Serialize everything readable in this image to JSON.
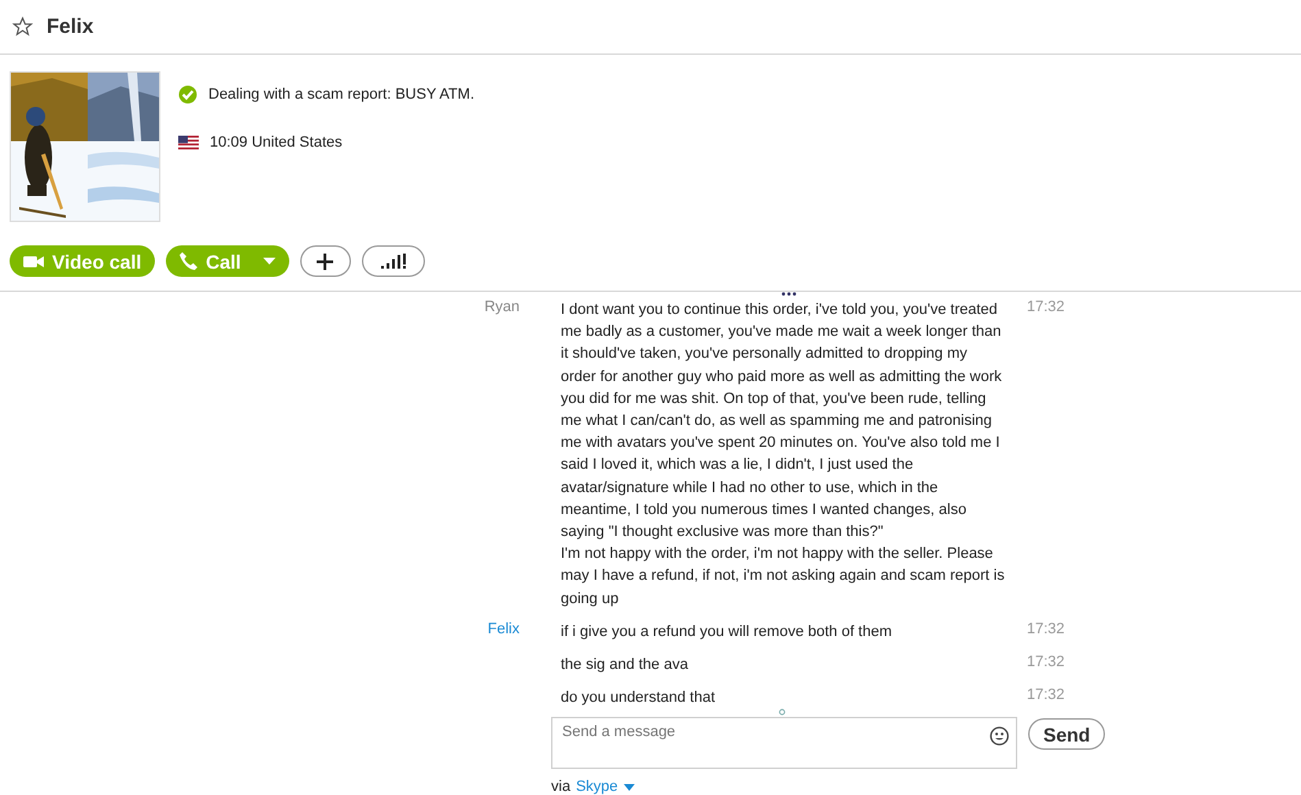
{
  "contact": {
    "name": "Felix",
    "favorite": false
  },
  "profile": {
    "kind": "picture",
    "mood": "Dealing with a scam report: BUSY ATM.",
    "local_time": "10:09 United States"
  },
  "actions": [
    {
      "kind": "video",
      "label": "Video call"
    },
    {
      "kind": "call",
      "label": "Call"
    },
    {
      "kind": "add"
    },
    {
      "kind": "quality"
    }
  ],
  "messages": [
    {
      "sender": "Ryan",
      "kind": "outgoing",
      "text": "I dont want you to continue this order, i've told you, you've treated me badly as a customer, you've made me wait a week longer than it should've taken, you've personally admitted to dropping my order for another guy who paid more as well as admitting the work you did for me was shit. On top of that, you've been rude, telling me what I can/can't do, as well as spamming me and patronising me with avatars you've spent 20 minutes on. You've also told me I said I loved it, which was a lie, I didn't, I just used the avatar/signature while I had no other to use, which in the meantime, I told you numerous times I wanted changes, also saying \"I thought exclusive was more than this?\"\nI'm not happy with the order, i'm not happy with the seller. Please may I have a refund, if not, i'm not asking again and scam report is going up",
      "time": "17:32"
    },
    {
      "sender": "Felix",
      "kind": "incoming",
      "text": "if i give you a refund you will remove both of them",
      "time": "17:32"
    },
    {
      "kind": "incoming",
      "text": "the sig and the ava",
      "time": "17:32"
    },
    {
      "kind": "incoming",
      "text": "do you understand that",
      "time": "17:32"
    }
  ],
  "compose": {
    "placeholder": "Send a message",
    "send": "Send",
    "via": "via",
    "network": "Skype"
  }
}
